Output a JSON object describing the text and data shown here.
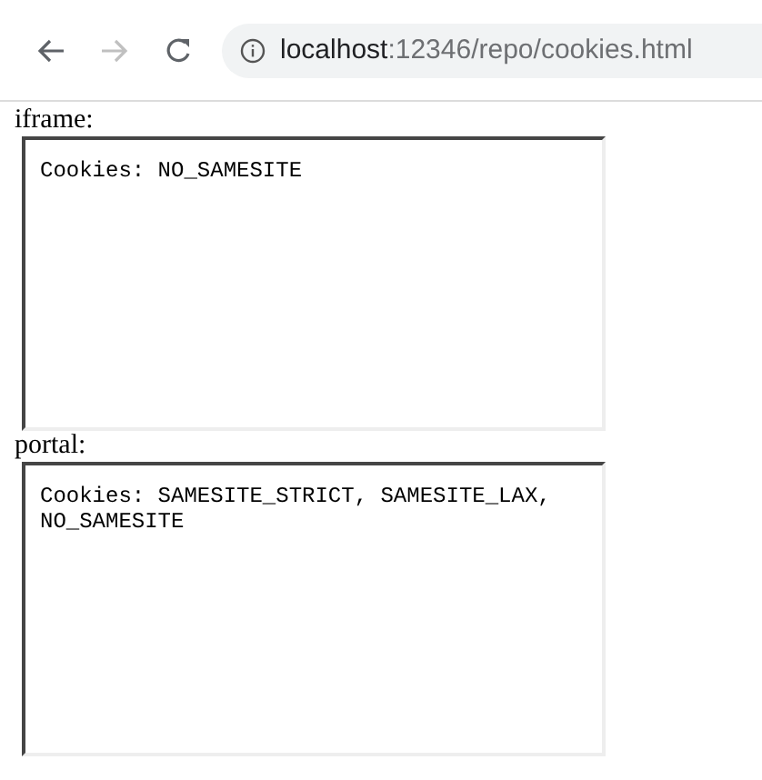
{
  "toolbar": {
    "back": {
      "disabled": false
    },
    "forward": {
      "disabled": true
    },
    "url": {
      "host": "localhost",
      "path": ":12346/repo/cookies.html"
    }
  },
  "frames": [
    {
      "label": "iframe:",
      "content": "Cookies: NO_SAMESITE"
    },
    {
      "label": "portal:",
      "content": "Cookies: SAMESITE_STRICT, SAMESITE_LAX, NO_SAMESITE"
    }
  ]
}
